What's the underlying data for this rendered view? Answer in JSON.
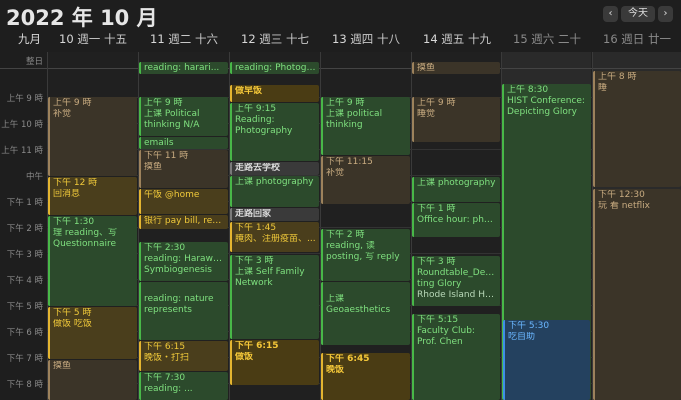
{
  "header": {
    "title": "2022 年 10 月",
    "prev": "‹",
    "today": "今天",
    "next": "›"
  },
  "days": [
    {
      "num": "九月",
      "label": ""
    },
    {
      "num": "10",
      "label": "週一  十五"
    },
    {
      "num": "11",
      "label": "週二  十六"
    },
    {
      "num": "12",
      "label": "週三  十七"
    },
    {
      "num": "13",
      "label": "週四  十八"
    },
    {
      "num": "14",
      "label": "週五  十九"
    },
    {
      "num": "15",
      "label": "週六  二十"
    },
    {
      "num": "16",
      "label": "週日  廿一"
    }
  ],
  "allday_label": "整日",
  "times": [
    "上午 9 時",
    "上午 10 時",
    "上午 11 時",
    "中午",
    "下午 1 時",
    "下午 2 時",
    "下午 3 時",
    "下午 4 時",
    "下午 5 時",
    "下午 6 時",
    "下午 7 時",
    "下午 8 時"
  ],
  "events": {
    "mon_nap": [
      "上午 9 時",
      "补觉"
    ],
    "mon_msg": [
      "下午 12 時",
      "回消息"
    ],
    "mon_reading": [
      "下午 1:30",
      "理 reading、写",
      "Questionnaire"
    ],
    "mon_dinner": [
      "下午 5 時",
      "做饭 吃饭"
    ],
    "mon_slack": [
      "摸鱼"
    ],
    "tue_top": [
      "reading: harari..."
    ],
    "tue_class": [
      "上午 9 時",
      "上课 Political",
      "thinking N/A"
    ],
    "tue_emails": [
      "emails"
    ],
    "tue_slack": [
      "下午 11 時",
      "摸鱼"
    ],
    "tue_lunch": [
      "午饭 @home"
    ],
    "tue_bank": [
      "银行 pay bill, red..."
    ],
    "tue_reading1": [
      "下午 2:30",
      "reading: Haraway.",
      "Symbiogenesis"
    ],
    "tue_reading2": [
      "reading: nature",
      "represents"
    ],
    "tue_dinner": [
      "下午 6:15",
      "晚饭・打扫"
    ],
    "tue_reading3": [
      "下午 7:30",
      "reading: ..."
    ],
    "wed_top": [
      "reading: Photogr..."
    ],
    "wed_breakfast": [
      "做早饭"
    ],
    "wed_reading": [
      "上午 9:15",
      "Reading:",
      "Photography"
    ],
    "wed_walk": [
      "走路去学校"
    ],
    "wed_class": [
      "上课 photography"
    ],
    "wed_walkhome": [
      "走路回家"
    ],
    "wed_cook": [
      "下午 1:45",
      "腌肉、注册疫苗、..."
    ],
    "wed_sfn": [
      "下午 3 時",
      "上课 Self Family",
      "Network"
    ],
    "wed_dinner": [
      "下午 6:15",
      "做饭"
    ],
    "thu_class": [
      "上午 9 時",
      "上课 political",
      "thinking"
    ],
    "thu_nap": [
      "下午 11:15",
      "补觉"
    ],
    "thu_reading": [
      "下午 2 時",
      "reading, 读",
      "posting, 写 reply"
    ],
    "thu_geo": [
      "上课",
      "Geoaesthetics"
    ],
    "thu_dinner": [
      "下午 6:45",
      "晚饭"
    ],
    "fri_top": [
      "摸鱼"
    ],
    "fri_sleep": [
      "上午 9 時",
      "睡觉"
    ],
    "fri_photo": [
      "上课 photography"
    ],
    "fri_office": [
      "下午 1 時",
      "Office hour: pho..."
    ],
    "fri_round": [
      "下午 3 時",
      "Roundtable_Depic",
      "ting Glory",
      "Rhode Island Hal..."
    ],
    "fri_faculty": [
      "下午 5:15",
      "Faculty Club:",
      "Prof. Chen"
    ],
    "sat_hist": [
      "上午 8:30",
      "HIST Conference:",
      "Depicting Glory"
    ],
    "sat_selfhelp": [
      "下午 5:30",
      "吃自助"
    ],
    "sun_sleep": [
      "上午 8 時",
      "睡"
    ],
    "sun_netflix": [
      "下午 12:30",
      "玩 看 netflix"
    ]
  },
  "colors": {
    "green": "#48b848",
    "yellow": "#e4b530",
    "brown": "#9d825c",
    "blue": "#3e8ee8",
    "gray": "#7a7a7a"
  }
}
